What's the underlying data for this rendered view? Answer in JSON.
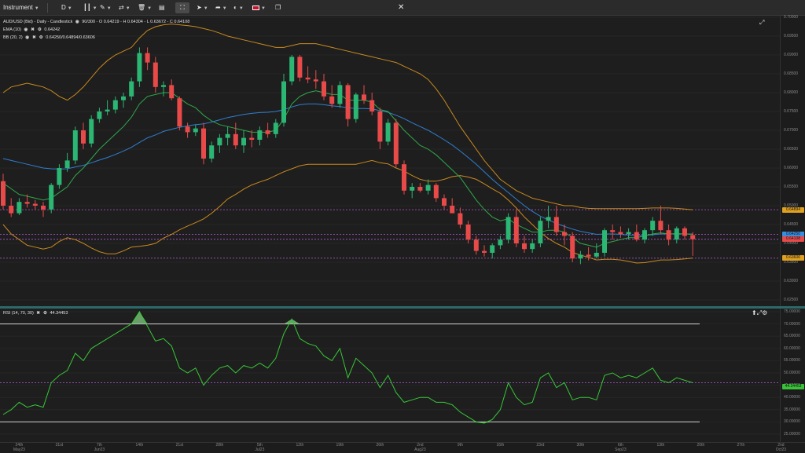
{
  "toolbar": {
    "instrument": "Instrument",
    "timeframe": "D",
    "flag_icon": "uk-flag-icon",
    "close_icon": "close-icon"
  },
  "legend": {
    "main": "AUD/USD (Bid) - Daily - Candlestick",
    "main_values": "90/300 - O 0.64219 - H 0.64304 - L 0.63672 - C 0.64108",
    "ema_name": "EMA (10)",
    "ema_value": "0.64242",
    "bb_name": "BB (20, 2)",
    "bb_value": "0.64250/0.64894/0.63606",
    "rsi_name": "RSI (14, 70, 30)",
    "rsi_value": "44.34453"
  },
  "price_axis": {
    "ticks": [
      "0.70000",
      "0.69500",
      "0.69000",
      "0.68500",
      "0.68000",
      "0.67500",
      "0.67000",
      "0.66500",
      "0.66000",
      "0.65500",
      "0.65000",
      "0.64500",
      "0.64000",
      "0.63500",
      "0.63000",
      "0.62500"
    ],
    "badges": [
      {
        "label": "0.64894",
        "color": "#e0a020"
      },
      {
        "label": "0.64242",
        "color": "#3ac23a"
      },
      {
        "label": "0.64250",
        "color": "#3a8ee0"
      },
      {
        "label": "0.64108",
        "color": "#e84a4a"
      },
      {
        "label": "0.63606",
        "color": "#e0a020"
      }
    ]
  },
  "rsi_axis": {
    "ticks": [
      "75.00000",
      "70.00000",
      "65.00000",
      "60.00000",
      "55.00000",
      "50.00000",
      "45.00000",
      "40.00000",
      "35.00000",
      "30.00000",
      "25.00000"
    ],
    "badge": "44.34453",
    "badge_color": "#3ac23a"
  },
  "time_axis": [
    {
      "top": "24th",
      "bottom": "May23"
    },
    {
      "top": "31st",
      "bottom": ""
    },
    {
      "top": "7th",
      "bottom": "Jun23"
    },
    {
      "top": "14th",
      "bottom": ""
    },
    {
      "top": "21st",
      "bottom": ""
    },
    {
      "top": "28th",
      "bottom": ""
    },
    {
      "top": "5th",
      "bottom": "Jul23"
    },
    {
      "top": "12th",
      "bottom": ""
    },
    {
      "top": "19th",
      "bottom": ""
    },
    {
      "top": "26th",
      "bottom": ""
    },
    {
      "top": "2nd",
      "bottom": "Aug23"
    },
    {
      "top": "9th",
      "bottom": ""
    },
    {
      "top": "16th",
      "bottom": ""
    },
    {
      "top": "23rd",
      "bottom": ""
    },
    {
      "top": "30th",
      "bottom": ""
    },
    {
      "top": "6th",
      "bottom": "Sep23"
    },
    {
      "top": "13th",
      "bottom": ""
    },
    {
      "top": "20th",
      "bottom": ""
    },
    {
      "top": "27th",
      "bottom": ""
    },
    {
      "top": "2nd",
      "bottom": "Oct23"
    }
  ],
  "chart_data": {
    "type": "candlestick",
    "instrument": "AUD/USD",
    "ylim": [
      0.625,
      0.7
    ],
    "levels": {
      "bb_upper": 0.64894,
      "ema": 0.64242,
      "bb_mid": 0.6425,
      "close": 0.64108,
      "bb_lower": 0.63606
    },
    "candles": [
      [
        0.6565,
        0.6585,
        0.649,
        0.65
      ],
      [
        0.65,
        0.652,
        0.647,
        0.648
      ],
      [
        0.648,
        0.652,
        0.6475,
        0.651
      ],
      [
        0.651,
        0.653,
        0.6495,
        0.6505
      ],
      [
        0.6505,
        0.6515,
        0.649,
        0.65
      ],
      [
        0.65,
        0.651,
        0.647,
        0.649
      ],
      [
        0.649,
        0.656,
        0.648,
        0.6555
      ],
      [
        0.6555,
        0.661,
        0.6545,
        0.66
      ],
      [
        0.66,
        0.664,
        0.659,
        0.662
      ],
      [
        0.662,
        0.671,
        0.661,
        0.67
      ],
      [
        0.67,
        0.672,
        0.665,
        0.6665
      ],
      [
        0.6665,
        0.674,
        0.6655,
        0.673
      ],
      [
        0.673,
        0.676,
        0.672,
        0.675
      ],
      [
        0.675,
        0.678,
        0.674,
        0.6755
      ],
      [
        0.6755,
        0.679,
        0.6745,
        0.678
      ],
      [
        0.678,
        0.68,
        0.676,
        0.679
      ],
      [
        0.679,
        0.684,
        0.678,
        0.683
      ],
      [
        0.683,
        0.692,
        0.6815,
        0.6905
      ],
      [
        0.6905,
        0.692,
        0.686,
        0.688
      ],
      [
        0.688,
        0.6895,
        0.68,
        0.6815
      ],
      [
        0.6815,
        0.683,
        0.679,
        0.682
      ],
      [
        0.682,
        0.6835,
        0.678,
        0.6785
      ],
      [
        0.6785,
        0.679,
        0.67,
        0.671
      ],
      [
        0.671,
        0.672,
        0.668,
        0.6695
      ],
      [
        0.6695,
        0.6715,
        0.6685,
        0.6705
      ],
      [
        0.6705,
        0.672,
        0.661,
        0.6625
      ],
      [
        0.6625,
        0.667,
        0.6615,
        0.666
      ],
      [
        0.666,
        0.669,
        0.664,
        0.668
      ],
      [
        0.668,
        0.671,
        0.666,
        0.669
      ],
      [
        0.669,
        0.672,
        0.665,
        0.666
      ],
      [
        0.666,
        0.67,
        0.664,
        0.668
      ],
      [
        0.668,
        0.67,
        0.6655,
        0.6675
      ],
      [
        0.6675,
        0.671,
        0.666,
        0.67
      ],
      [
        0.67,
        0.672,
        0.668,
        0.669
      ],
      [
        0.669,
        0.673,
        0.668,
        0.672
      ],
      [
        0.672,
        0.685,
        0.671,
        0.683
      ],
      [
        0.683,
        0.69,
        0.682,
        0.6895
      ],
      [
        0.6895,
        0.69,
        0.683,
        0.684
      ],
      [
        0.684,
        0.687,
        0.6825,
        0.6835
      ],
      [
        0.6835,
        0.686,
        0.681,
        0.683
      ],
      [
        0.683,
        0.685,
        0.678,
        0.679
      ],
      [
        0.679,
        0.682,
        0.676,
        0.677
      ],
      [
        0.677,
        0.683,
        0.676,
        0.682
      ],
      [
        0.682,
        0.6825,
        0.671,
        0.673
      ],
      [
        0.673,
        0.68,
        0.672,
        0.6795
      ],
      [
        0.6795,
        0.682,
        0.677,
        0.678
      ],
      [
        0.678,
        0.68,
        0.674,
        0.675
      ],
      [
        0.675,
        0.676,
        0.665,
        0.667
      ],
      [
        0.667,
        0.673,
        0.666,
        0.672
      ],
      [
        0.672,
        0.673,
        0.66,
        0.661
      ],
      [
        0.661,
        0.662,
        0.653,
        0.654
      ],
      [
        0.654,
        0.656,
        0.652,
        0.655
      ],
      [
        0.655,
        0.656,
        0.6535,
        0.654
      ],
      [
        0.654,
        0.657,
        0.653,
        0.6555
      ],
      [
        0.6555,
        0.656,
        0.651,
        0.652
      ],
      [
        0.652,
        0.653,
        0.649,
        0.65
      ],
      [
        0.65,
        0.652,
        0.648,
        0.648
      ],
      [
        0.648,
        0.6495,
        0.644,
        0.645
      ],
      [
        0.645,
        0.646,
        0.64,
        0.641
      ],
      [
        0.641,
        0.642,
        0.637,
        0.638
      ],
      [
        0.638,
        0.6395,
        0.6365,
        0.6375
      ],
      [
        0.6375,
        0.64,
        0.636,
        0.6395
      ],
      [
        0.6395,
        0.642,
        0.6385,
        0.641
      ],
      [
        0.641,
        0.648,
        0.64,
        0.647
      ],
      [
        0.647,
        0.649,
        0.639,
        0.64
      ],
      [
        0.64,
        0.642,
        0.6375,
        0.6385
      ],
      [
        0.6385,
        0.641,
        0.6375,
        0.64
      ],
      [
        0.64,
        0.647,
        0.639,
        0.646
      ],
      [
        0.646,
        0.65,
        0.644,
        0.647
      ],
      [
        0.647,
        0.65,
        0.642,
        0.643
      ],
      [
        0.643,
        0.645,
        0.6395,
        0.642
      ],
      [
        0.642,
        0.643,
        0.635,
        0.636
      ],
      [
        0.636,
        0.638,
        0.6345,
        0.637
      ],
      [
        0.637,
        0.639,
        0.6355,
        0.6365
      ],
      [
        0.6365,
        0.64,
        0.636,
        0.6375
      ],
      [
        0.6375,
        0.644,
        0.6365,
        0.6435
      ],
      [
        0.6435,
        0.645,
        0.641,
        0.643
      ],
      [
        0.643,
        0.6445,
        0.6415,
        0.6425
      ],
      [
        0.6425,
        0.644,
        0.641,
        0.643
      ],
      [
        0.643,
        0.645,
        0.6405,
        0.641
      ],
      [
        0.641,
        0.644,
        0.64,
        0.6435
      ],
      [
        0.6435,
        0.647,
        0.642,
        0.646
      ],
      [
        0.646,
        0.65,
        0.6425,
        0.6435
      ],
      [
        0.6435,
        0.645,
        0.6395,
        0.641
      ],
      [
        0.641,
        0.6445,
        0.64,
        0.644
      ],
      [
        0.644,
        0.6445,
        0.641,
        0.642
      ],
      [
        0.6422,
        0.643,
        0.6367,
        0.6411
      ]
    ],
    "ema": [
      0.656,
      0.6545,
      0.653,
      0.6525,
      0.652,
      0.6515,
      0.652,
      0.6535,
      0.655,
      0.658,
      0.66,
      0.6625,
      0.665,
      0.667,
      0.669,
      0.671,
      0.6735,
      0.677,
      0.679,
      0.6795,
      0.68,
      0.68,
      0.6785,
      0.677,
      0.676,
      0.674,
      0.6725,
      0.6715,
      0.671,
      0.6705,
      0.67,
      0.6695,
      0.6695,
      0.6695,
      0.67,
      0.673,
      0.677,
      0.679,
      0.68,
      0.6805,
      0.68,
      0.6795,
      0.6795,
      0.678,
      0.678,
      0.678,
      0.6775,
      0.6755,
      0.675,
      0.6725,
      0.67,
      0.668,
      0.666,
      0.665,
      0.6635,
      0.6615,
      0.6595,
      0.6575,
      0.6545,
      0.6515,
      0.649,
      0.647,
      0.646,
      0.6465,
      0.645,
      0.644,
      0.643,
      0.643,
      0.6435,
      0.6435,
      0.643,
      0.6415,
      0.64,
      0.6395,
      0.639,
      0.64,
      0.6405,
      0.641,
      0.6415,
      0.6415,
      0.642,
      0.6425,
      0.6428,
      0.6425,
      0.6426,
      0.6425,
      0.6424
    ],
    "bb_mid": [
      0.6625,
      0.662,
      0.6615,
      0.661,
      0.6605,
      0.66,
      0.6598,
      0.6597,
      0.6598,
      0.6603,
      0.6607,
      0.6614,
      0.6621,
      0.6628,
      0.6636,
      0.6645,
      0.6655,
      0.6668,
      0.668,
      0.6688,
      0.6697,
      0.6703,
      0.6708,
      0.6712,
      0.6715,
      0.6717,
      0.6722,
      0.6728,
      0.6734,
      0.6738,
      0.6742,
      0.6745,
      0.6747,
      0.6748,
      0.675,
      0.6755,
      0.6762,
      0.6768,
      0.677,
      0.677,
      0.6768,
      0.6765,
      0.6763,
      0.676,
      0.6758,
      0.6758,
      0.6757,
      0.6752,
      0.6748,
      0.674,
      0.6731,
      0.672,
      0.671,
      0.67,
      0.6688,
      0.6675,
      0.6661,
      0.6645,
      0.6628,
      0.661,
      0.659,
      0.657,
      0.6552,
      0.6535,
      0.6517,
      0.65,
      0.6485,
      0.6472,
      0.6462,
      0.6453,
      0.6445,
      0.6438,
      0.6432,
      0.6428,
      0.6424,
      0.6425,
      0.6425,
      0.6424,
      0.6422,
      0.642,
      0.6421,
      0.6423,
      0.6425,
      0.6425,
      0.6425,
      0.6425,
      0.6425
    ],
    "bb_upper": [
      0.68,
      0.6815,
      0.682,
      0.6825,
      0.682,
      0.6815,
      0.6805,
      0.679,
      0.678,
      0.6795,
      0.6815,
      0.684,
      0.6865,
      0.6885,
      0.69,
      0.691,
      0.692,
      0.6945,
      0.6965,
      0.6975,
      0.698,
      0.6982,
      0.698,
      0.6978,
      0.6975,
      0.697,
      0.6965,
      0.6958,
      0.695,
      0.6945,
      0.694,
      0.6935,
      0.693,
      0.6925,
      0.692,
      0.692,
      0.6925,
      0.693,
      0.693,
      0.693,
      0.6925,
      0.692,
      0.6915,
      0.691,
      0.6905,
      0.69,
      0.6895,
      0.689,
      0.6885,
      0.688,
      0.687,
      0.686,
      0.685,
      0.6835,
      0.681,
      0.678,
      0.6745,
      0.671,
      0.668,
      0.665,
      0.662,
      0.6595,
      0.657,
      0.6555,
      0.654,
      0.653,
      0.652,
      0.6515,
      0.651,
      0.6505,
      0.65,
      0.65,
      0.6495,
      0.6493,
      0.6492,
      0.6492,
      0.6492,
      0.6492,
      0.6492,
      0.6492,
      0.6493,
      0.6494,
      0.6494,
      0.6494,
      0.6493,
      0.6491,
      0.6489
    ],
    "bb_lower": [
      0.645,
      0.6425,
      0.641,
      0.6395,
      0.639,
      0.6385,
      0.639,
      0.6405,
      0.6415,
      0.641,
      0.64,
      0.6388,
      0.6378,
      0.6372,
      0.6372,
      0.638,
      0.639,
      0.6392,
      0.6395,
      0.64,
      0.6414,
      0.6424,
      0.6436,
      0.6446,
      0.6455,
      0.6465,
      0.648,
      0.6498,
      0.6518,
      0.653,
      0.6544,
      0.6555,
      0.6563,
      0.657,
      0.658,
      0.659,
      0.6598,
      0.6606,
      0.661,
      0.661,
      0.661,
      0.661,
      0.661,
      0.661,
      0.661,
      0.6615,
      0.662,
      0.6614,
      0.6611,
      0.66,
      0.6592,
      0.658,
      0.657,
      0.6565,
      0.6565,
      0.657,
      0.6577,
      0.658,
      0.6576,
      0.657,
      0.6558,
      0.6545,
      0.6533,
      0.6515,
      0.6494,
      0.647,
      0.645,
      0.6429,
      0.6413,
      0.64,
      0.639,
      0.6376,
      0.6369,
      0.6363,
      0.6356,
      0.6358,
      0.6358,
      0.6356,
      0.6352,
      0.6348,
      0.6349,
      0.6352,
      0.6356,
      0.6356,
      0.6357,
      0.6359,
      0.6361
    ],
    "rsi": [
      33,
      35,
      38,
      36,
      37,
      36,
      46,
      49,
      51,
      58,
      55,
      60,
      62,
      64,
      66,
      68,
      70,
      75,
      69,
      63,
      64,
      61,
      52,
      50,
      52,
      45,
      49,
      52,
      53,
      50,
      53,
      52,
      54,
      52,
      56,
      66,
      72,
      64,
      62,
      61,
      57,
      55,
      60,
      48,
      56,
      53,
      50,
      44,
      49,
      42,
      38,
      39,
      40,
      40,
      38,
      38,
      37,
      34,
      32,
      30,
      29.5,
      31,
      35,
      46,
      40,
      37,
      38,
      48,
      50,
      44,
      46,
      39,
      40,
      40,
      39,
      49,
      50,
      48,
      49,
      48,
      50,
      52,
      47,
      46,
      48,
      47,
      46
    ],
    "rsi_levels": {
      "upper": 70,
      "lower": 30,
      "ylim": [
        25,
        75
      ]
    }
  }
}
